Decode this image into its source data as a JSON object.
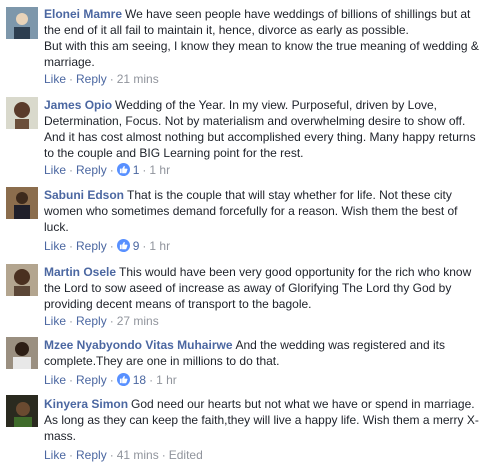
{
  "actions": {
    "like": "Like",
    "reply": "Reply",
    "separator": "·"
  },
  "colors": {
    "name": "#4b67a1",
    "meta": "#90949c",
    "like_badge": "#5890ff",
    "text": "#1d2129"
  },
  "comments": [
    {
      "author": "Elonei Mamre",
      "text": "We have seen people have weddings of billions of shillings but at the end of it all fail to maintain it, hence, divorce as early as possible.",
      "text_2": "But with this am seeing, I know they mean to know the true meaning of wedding & marriage.",
      "time": "21 mins",
      "likes": ""
    },
    {
      "author": "James Opio",
      "text": "Wedding of the Year. In my view. Purposeful, driven by Love, Determination, Focus. Not by materialism and overwhelming desire to show off. And it has cost almost nothing but accomplished every thing. Many happy returns to the couple and BIG Learning point for the rest.",
      "time": "1 hr",
      "likes": "1"
    },
    {
      "author": "Sabuni Edson",
      "text": "That is the couple that will stay whether for life. Not these city women who sometimes demand forcefully for a reason. Wish them the best of luck.",
      "time": "1 hr",
      "likes": "9"
    },
    {
      "author": "Martin Osele",
      "text": "This would have been very good opportunity for the rich who know the Lord to sow aseed of increase as away of Glorifying The Lord thy God by providing decent means of transport to the bagole.",
      "time": "27 mins",
      "likes": ""
    },
    {
      "author": "Mzee Nyabyondo Vitas Muhairwe",
      "text": "And the wedding was registered and its complete.They are one in millions to do that.",
      "time": "1 hr",
      "likes": "18"
    },
    {
      "author": "Kinyera Simon",
      "text": "God need our hearts but not what we have or spend in marriage. As long as they can keep the faith,they will live a happy life. Wish them a merry X-mass.",
      "time": "41 mins",
      "edited": "Edited",
      "likes": ""
    }
  ],
  "icons": {
    "avatar": "profile-photo",
    "like_badge": "thumbs-up-icon"
  }
}
